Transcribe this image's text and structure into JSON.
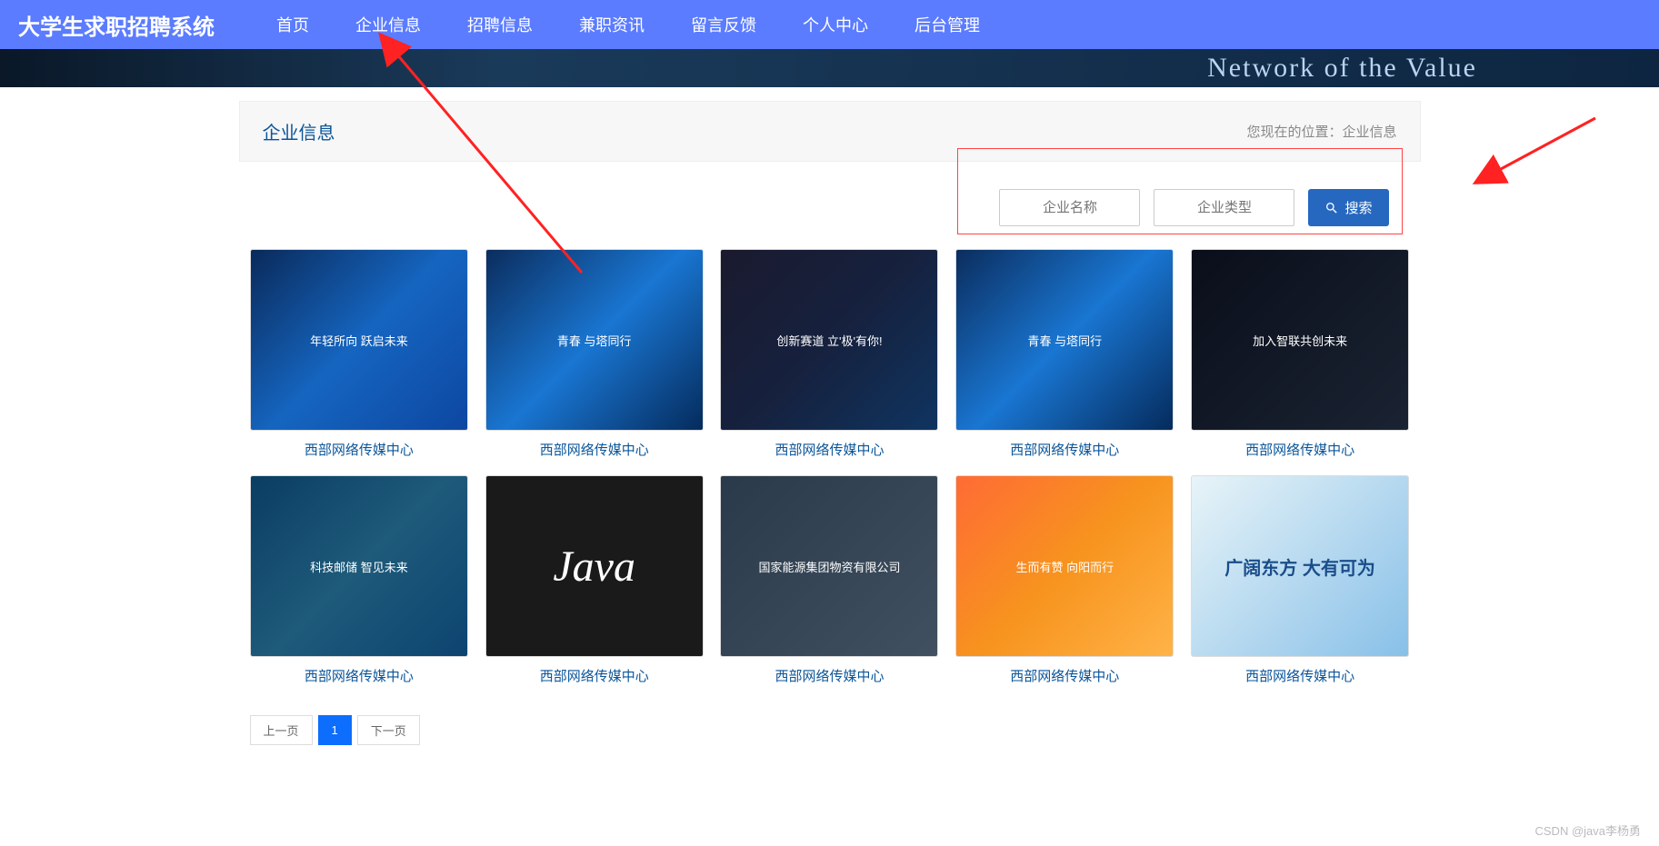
{
  "brand": "大学生求职招聘系统",
  "nav": {
    "items": [
      {
        "label": "首页"
      },
      {
        "label": "企业信息"
      },
      {
        "label": "招聘信息"
      },
      {
        "label": "兼职资讯"
      },
      {
        "label": "留言反馈"
      },
      {
        "label": "个人中心"
      },
      {
        "label": "后台管理"
      }
    ]
  },
  "hero": {
    "text": "Network of the Value"
  },
  "section": {
    "title": "企业信息",
    "breadcrumb_prefix": "您现在的位置：",
    "breadcrumb_current": "企业信息"
  },
  "search": {
    "input1_placeholder": "企业名称",
    "input2_placeholder": "企业类型",
    "button_label": "搜索"
  },
  "cards": {
    "row1": [
      {
        "title": "西部网络传媒中心",
        "img_class": "img-blue1",
        "overlay": "年轻所向 跃启未来"
      },
      {
        "title": "西部网络传媒中心",
        "img_class": "img-blue2",
        "overlay": "青春 与塔同行"
      },
      {
        "title": "西部网络传媒中心",
        "img_class": "img-dark1",
        "overlay": "创新赛道 立'极'有你!"
      },
      {
        "title": "西部网络传媒中心",
        "img_class": "img-blue2",
        "overlay": "青春 与塔同行"
      },
      {
        "title": "西部网络传媒中心",
        "img_class": "img-black1",
        "overlay": "加入智联共创未来"
      }
    ],
    "row2": [
      {
        "title": "西部网络传媒中心",
        "img_class": "img-teal1",
        "overlay": "科技邮储 智见未来"
      },
      {
        "title": "西部网络传媒中心",
        "img_class": "img-dark2",
        "overlay": "Java"
      },
      {
        "title": "西部网络传媒中心",
        "img_class": "img-gray1",
        "overlay": "国家能源集团物资有限公司"
      },
      {
        "title": "西部网络传媒中心",
        "img_class": "img-orange1",
        "overlay": "生而有赞 向阳而行"
      },
      {
        "title": "西部网络传媒中心",
        "img_class": "img-light1",
        "overlay": "广阔东方 大有可为"
      }
    ]
  },
  "pagination": {
    "prev": "上一页",
    "page1": "1",
    "next": "下一页"
  },
  "watermark": "CSDN @java李杨勇"
}
